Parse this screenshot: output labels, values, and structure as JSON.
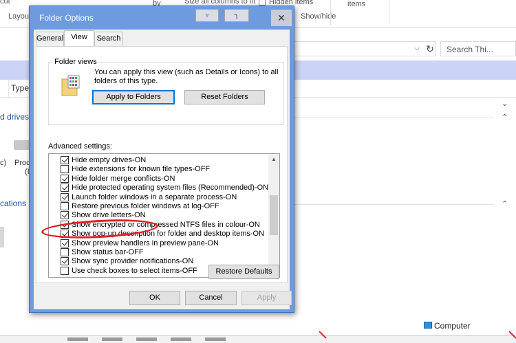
{
  "explorer": {
    "ribbon": {
      "top_left_fragment": "cut",
      "layout_label": "Layou",
      "sort_by_label": "by",
      "size_columns_label": "Size all columns to fit",
      "hidden_items_label": "Hidden items",
      "items_label": "items",
      "show_hide_label": "Show/hide"
    },
    "search_placeholder": "Search Thi...",
    "column_type_label": "Type",
    "group_drives_label": "d drives (",
    "drive_label_left": "c)",
    "drive_label_pro": "Proc",
    "drive_label_paren": "(I",
    "group_locations_label": "cations (",
    "status_computer_label": "Computer"
  },
  "dialog": {
    "title": "Folder Options",
    "tabs": [
      {
        "label": "General",
        "active": false
      },
      {
        "label": "View",
        "active": true
      },
      {
        "label": "Search",
        "active": false
      }
    ],
    "folder_views": {
      "legend": "Folder views",
      "description": "You can apply this view (such as Details or Icons) to all folders of this type.",
      "apply_button": "Apply to Folders",
      "reset_button": "Reset Folders"
    },
    "advanced_settings_label": "Advanced settings:",
    "advanced_items": [
      {
        "label": "Hide empty drives-ON",
        "checked": true
      },
      {
        "label": "Hide extensions for known file types-OFF",
        "checked": false
      },
      {
        "label": "Hide folder merge conflicts-ON",
        "checked": true
      },
      {
        "label": "Hide protected operating system files (Recommended)-ON",
        "checked": true
      },
      {
        "label": "Launch folder windows in a separate process-ON",
        "checked": true
      },
      {
        "label": "Restore previous folder windows at log-OFF",
        "checked": false
      },
      {
        "label": "Show drive letters-ON",
        "checked": true
      },
      {
        "label": "Show encrypted or compressed NTFS files in colour-ON",
        "checked": true
      },
      {
        "label": "Show pop-up description for folder and desktop items-ON",
        "checked": true
      },
      {
        "label": "Show preview handlers in preview pane-ON",
        "checked": true
      },
      {
        "label": "Show status bar-OFF",
        "checked": false
      },
      {
        "label": "Show sync provider notifications-ON",
        "checked": true
      },
      {
        "label": "Use check boxes to select items-OFF",
        "checked": false
      }
    ],
    "restore_defaults_button": "Restore Defaults",
    "ok_button": "OK",
    "cancel_button": "Cancel",
    "apply_button": "Apply",
    "close_glyph": "✕"
  },
  "colors": {
    "dialog_title_bg": "#6e9be0",
    "selection_band": "#cbd3f7",
    "annotation_red": "#e0202a",
    "group_header_blue": "#1e4e9b"
  }
}
